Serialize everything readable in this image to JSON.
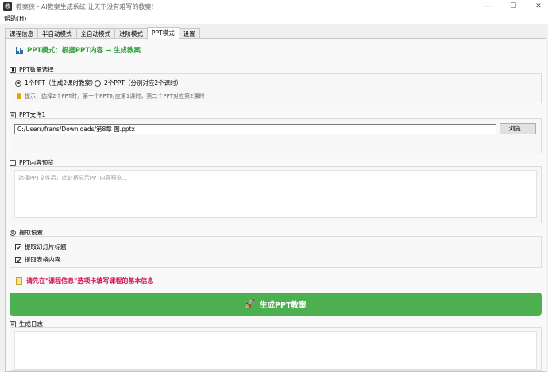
{
  "window": {
    "title": "教案侠 - AI教案生成系统   让天下没有难写的教案!",
    "icon_text": "教",
    "controls": [
      "—",
      "☐",
      "✕"
    ]
  },
  "menu": {
    "help": "帮助(H)"
  },
  "tabs": [
    {
      "label": "课程信息",
      "active": false
    },
    {
      "label": "半自动模式",
      "active": false
    },
    {
      "label": "全自动模式",
      "active": false
    },
    {
      "label": "进阶模式",
      "active": false
    },
    {
      "label": "PPT模式",
      "active": true
    },
    {
      "label": "设置",
      "active": false
    }
  ],
  "ppt_mode": {
    "heading": "PPT模式：根据PPT内容 → 生成教案",
    "count_group": {
      "title": "PPT数量选择",
      "option1": "1个PPT（生成2课时教案）",
      "option2": "2个PPT（分别对应2个课时）",
      "selected": 1,
      "hint": "提示：选择2个PPT时，第一个PPT对应第1课时，第二个PPT对应第2课时"
    },
    "file_group": {
      "title": "PPT文件1",
      "path_value": "C:/Users/frans/Downloads/第8章 图.pptx",
      "browse_label": "浏览..."
    },
    "preview_group": {
      "title": "PPT内容预览",
      "placeholder": "选择PPT文件后，此处将显示PPT内容预览..."
    },
    "extract_group": {
      "title": "提取设置",
      "opt_titles": "提取幻灯片标题",
      "opt_tables": "提取表格内容",
      "titles_checked": true,
      "tables_checked": true
    },
    "warning": "请先在\"课程信息\"选项卡填写课程的基本信息",
    "generate_label": "生成PPT教案",
    "log_group": {
      "title": "生成日志"
    }
  },
  "colors": {
    "accent_green": "#4caf50",
    "heading_green": "#2f9b3a",
    "warning_red": "#d0114e"
  }
}
